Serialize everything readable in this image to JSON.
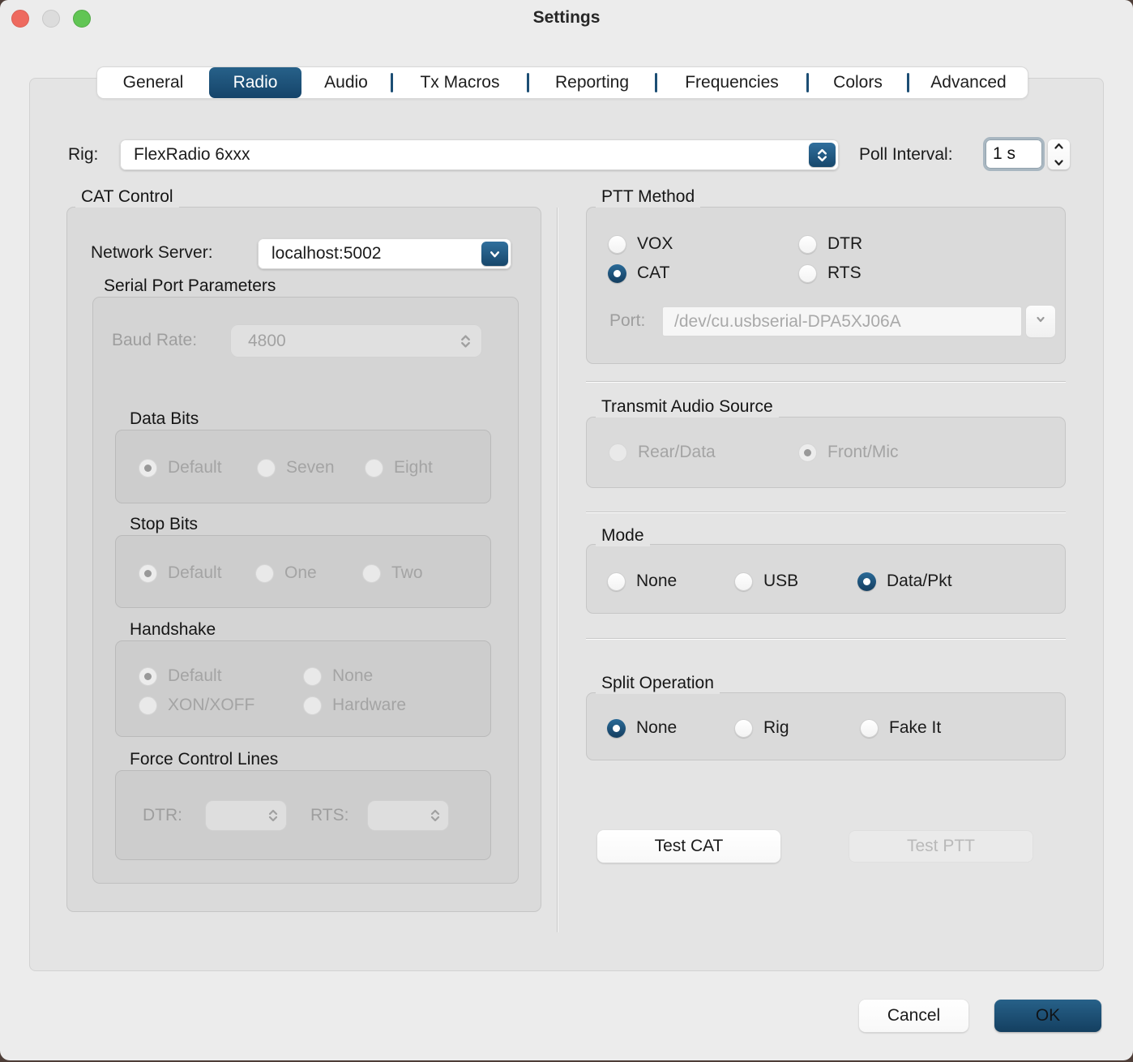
{
  "titlebar": {
    "title": "Settings"
  },
  "tabs": {
    "items": [
      "General",
      "Radio",
      "Audio",
      "Tx Macros",
      "Reporting",
      "Frequencies",
      "Colors",
      "Advanced"
    ],
    "active": "Radio"
  },
  "rig": {
    "label": "Rig:",
    "value": "FlexRadio 6xxx"
  },
  "poll_interval": {
    "label": "Poll Interval:",
    "value": "1 s"
  },
  "cat_control": {
    "title": "CAT Control",
    "network_server_label": "Network Server:",
    "network_server_value": "localhost:5002",
    "serial_title": "Serial Port Parameters",
    "baud_label": "Baud Rate:",
    "baud_value": "4800",
    "data_bits": {
      "title": "Data Bits",
      "options": [
        "Default",
        "Seven",
        "Eight"
      ],
      "selected": "Default"
    },
    "stop_bits": {
      "title": "Stop Bits",
      "options": [
        "Default",
        "One",
        "Two"
      ],
      "selected": "Default"
    },
    "handshake": {
      "title": "Handshake",
      "options": [
        "Default",
        "None",
        "XON/XOFF",
        "Hardware"
      ],
      "selected": "Default"
    },
    "force_control": {
      "title": "Force Control Lines",
      "dtr_label": "DTR:",
      "rts_label": "RTS:"
    }
  },
  "ptt_method": {
    "title": "PTT Method",
    "options": [
      "VOX",
      "CAT",
      "DTR",
      "RTS"
    ],
    "selected": "CAT",
    "port_label": "Port:",
    "port_value": "/dev/cu.usbserial-DPA5XJ06A"
  },
  "transmit_audio": {
    "title": "Transmit Audio Source",
    "options": [
      "Rear/Data",
      "Front/Mic"
    ],
    "selected": "Front/Mic"
  },
  "mode": {
    "title": "Mode",
    "options": [
      "None",
      "USB",
      "Data/Pkt"
    ],
    "selected": "Data/Pkt"
  },
  "split": {
    "title": "Split Operation",
    "options": [
      "None",
      "Rig",
      "Fake It"
    ],
    "selected": "None"
  },
  "actions": {
    "test_cat": "Test CAT",
    "test_ptt": "Test PTT",
    "cancel": "Cancel",
    "ok": "OK"
  },
  "colors": {
    "accent": "#1c4f74",
    "traffic_red": "#ee6a5f",
    "traffic_gray": "#dcdcdc",
    "traffic_green": "#61c554"
  }
}
